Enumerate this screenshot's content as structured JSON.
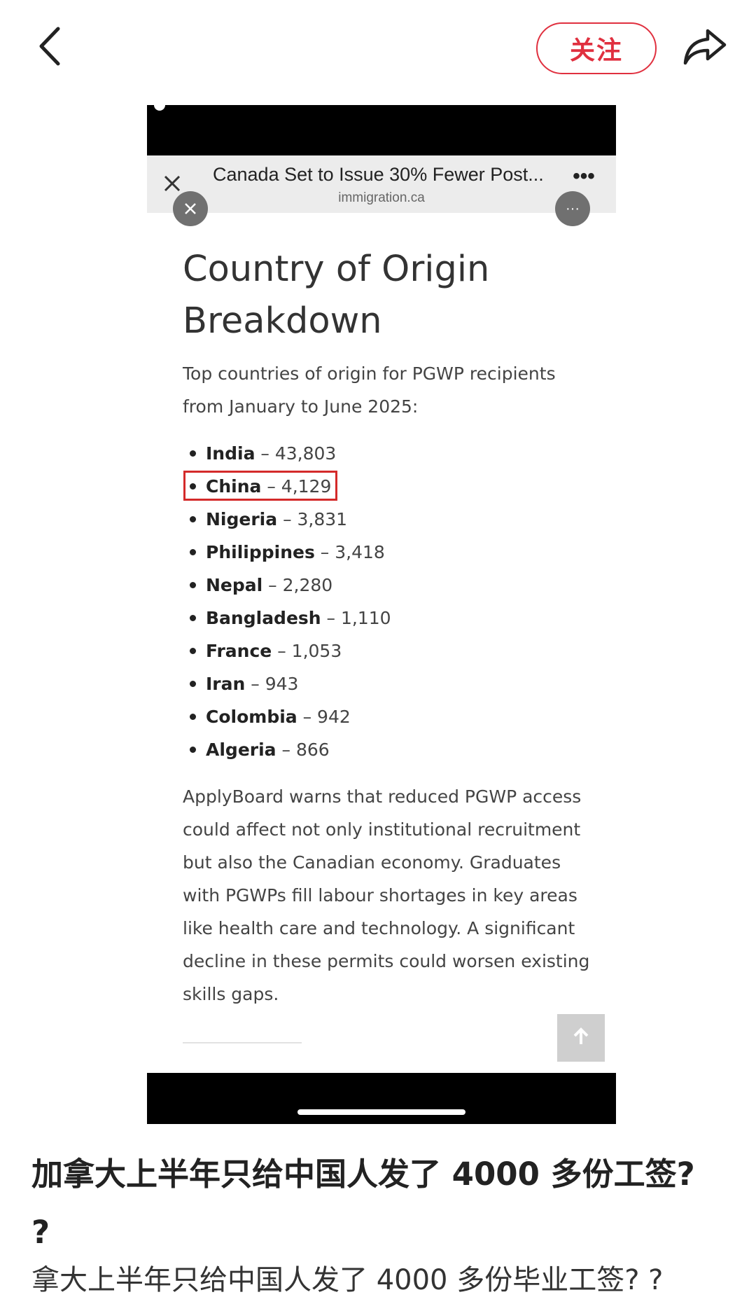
{
  "topbar": {
    "back_icon": "chevron-left-icon",
    "follow_label": "关注",
    "share_icon": "share-arrow-icon",
    "accent_color": "#e0303f"
  },
  "browser_banner": {
    "close_icon": "close-icon",
    "title": "Canada Set to Issue 30% Fewer Post...",
    "url": "immigration.ca",
    "more_icon": "more-dots-icon",
    "more_label": "•••",
    "floating_more_label": "···"
  },
  "article": {
    "heading": "Country of Origin Breakdown",
    "intro": "Top countries of origin for PGWP recipients from January to June 2025:",
    "countries": [
      {
        "name": "India",
        "count": " – 43,803"
      },
      {
        "name": "China",
        "count": " – 4,129"
      },
      {
        "name": "Nigeria",
        "count": " – 3,831"
      },
      {
        "name": "Philippines",
        "count": " – 3,418"
      },
      {
        "name": "Nepal",
        "count": " – 2,280"
      },
      {
        "name": "Bangladesh",
        "count": " – 1,110"
      },
      {
        "name": "France",
        "count": " – 1,053"
      },
      {
        "name": "Iran",
        "count": " – 943"
      },
      {
        "name": "Colombia",
        "count": " – 942"
      },
      {
        "name": "Algeria",
        "count": " – 866"
      }
    ],
    "highlighted_country": "China",
    "highlight_color": "#d42a2a",
    "body": "ApplyBoard warns that reduced PGWP access could affect not only institutional recruitment but also the Canadian economy. Graduates with PGWPs fill labour shortages in key areas like health care and technology. A significant decline in these permits could worsen existing skills gaps.",
    "scroll_top_icon": "arrow-up-icon"
  },
  "post": {
    "title": "加拿大上半年只给中国人发了 4000 多份工签? ?",
    "body": "拿大上半年只给中国人发了 4000 多份毕业工签? ?"
  }
}
